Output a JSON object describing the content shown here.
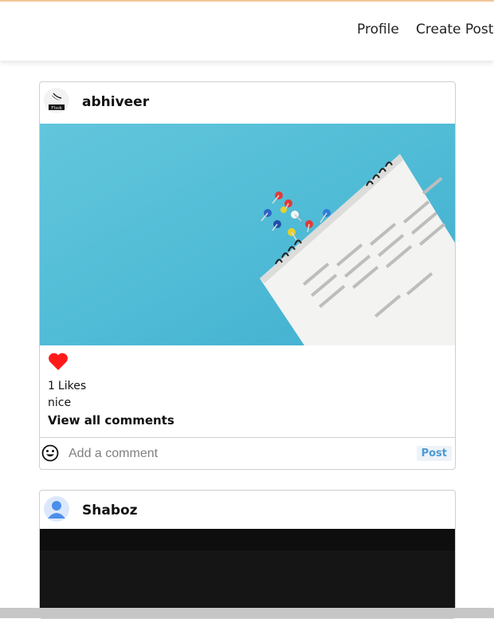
{
  "nav": {
    "profile_label": "Profile",
    "create_post_label": "Create Post"
  },
  "posts": [
    {
      "username": "abhiveer",
      "avatar_text": "Flask",
      "liked": true,
      "likes_count": "1",
      "likes_label": "Likes",
      "caption": "nice",
      "view_comments_label": "View all comments",
      "comment_placeholder": "Add a comment",
      "post_button_label": "Post"
    },
    {
      "username": "Shaboz"
    }
  ],
  "colors": {
    "heart": "#ff1a1a",
    "post_button": "#4a9bd6",
    "image_bg": "#5cc0d8"
  }
}
